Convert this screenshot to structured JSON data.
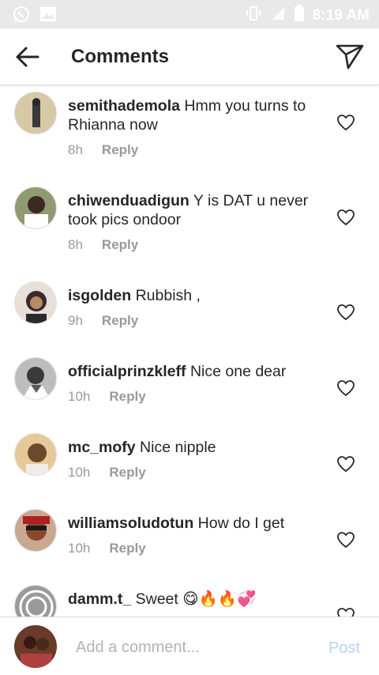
{
  "status_bar": {
    "time": "8:19 AM",
    "left_icons": [
      "whatsapp-icon",
      "image-icon"
    ],
    "right_icons": [
      "vibrate-icon",
      "signal-icon",
      "battery-icon"
    ]
  },
  "header": {
    "title": "Comments",
    "back_icon": "back-arrow-icon",
    "send_icon": "direct-send-icon"
  },
  "comments": [
    {
      "username": "semithademola",
      "text": "Hmm you turns to Rhianna now",
      "time": "8h",
      "reply": "Reply",
      "avatar_color": "#c9b48e"
    },
    {
      "username": "chiwenduadigun",
      "text": "Y is DAT u never took pics ondoor",
      "time": "8h",
      "reply": "Reply",
      "avatar_color": "#5d6a47"
    },
    {
      "username": "isgolden",
      "text": "Rubbish ,",
      "time": "9h",
      "reply": "Reply",
      "avatar_color": "#3a2a2a"
    },
    {
      "username": "officialprinzkleff",
      "text": "Nice one dear",
      "time": "10h",
      "reply": "Reply",
      "avatar_color": "#7a7a7a"
    },
    {
      "username": "mc_mofy",
      "text": "Nice nipple",
      "time": "10h",
      "reply": "Reply",
      "avatar_color": "#d6b07a"
    },
    {
      "username": "williamsoludotun",
      "text": "How do I get",
      "time": "10h",
      "reply": "Reply",
      "avatar_color": "#9a5a3a"
    },
    {
      "username": "damm.t_",
      "text": "Sweet 😋🔥🔥💞",
      "time": "",
      "reply": "",
      "avatar_color": "#8a8a8a"
    }
  ],
  "composer": {
    "placeholder": "Add a comment...",
    "post_label": "Post",
    "avatar_color": "#6a3a2a"
  },
  "colors": {
    "text": "#262626",
    "meta": "#999999",
    "post_disabled": "#b3d5f3",
    "status_bar": "#e9e9e9"
  }
}
